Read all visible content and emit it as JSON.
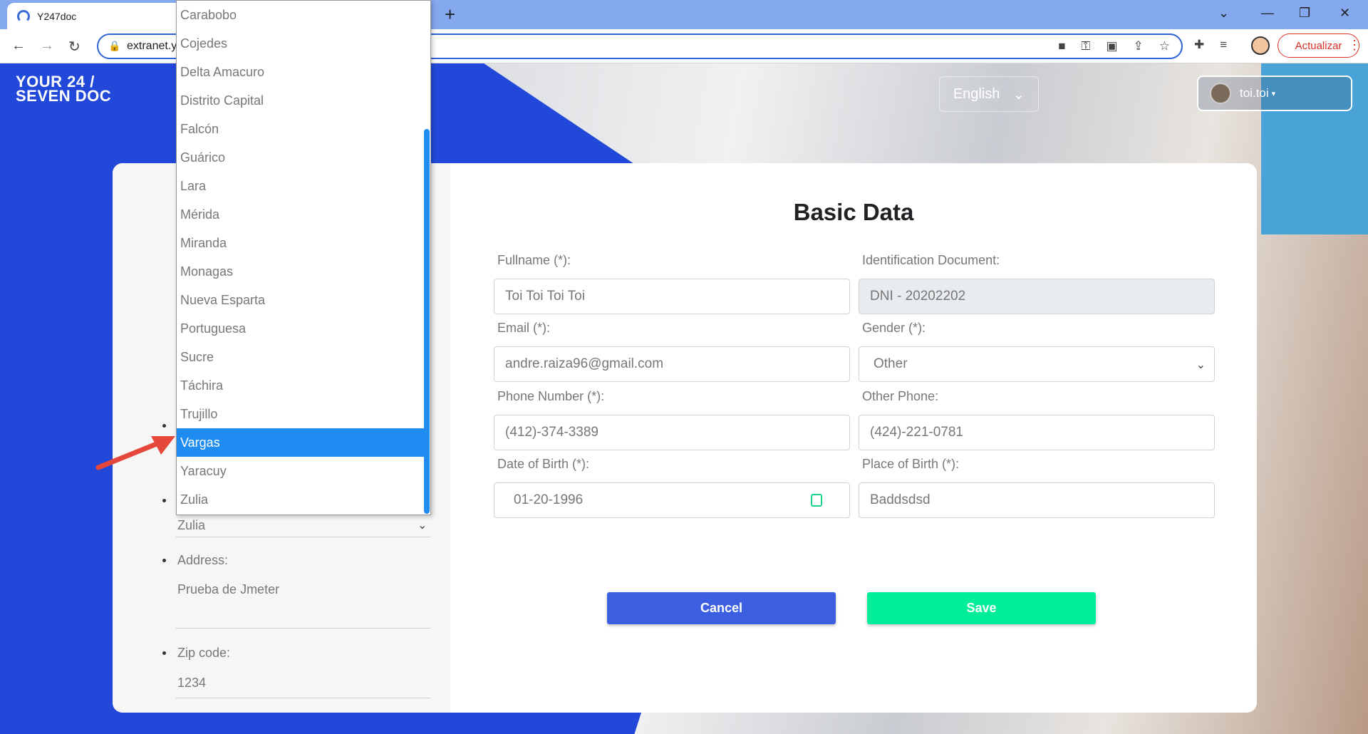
{
  "browser": {
    "tab_title": "Y247doc",
    "new_tab_icon": "plus-icon",
    "url": "extranet.y",
    "update_label": "Actualizar",
    "window_controls": [
      "⌄",
      "—",
      "❐",
      "✕"
    ]
  },
  "header": {
    "logo_line1": "YOUR 24 /",
    "logo_line2": "SEVEN DOC",
    "language": "English",
    "username": "toi.toi"
  },
  "left_panel": {
    "state_value": "Zulia",
    "address_label": "Address:",
    "address_value": "Prueba de Jmeter",
    "zip_label": "Zip code:",
    "zip_value": "1234"
  },
  "state_dropdown": {
    "options": [
      "Carabobo",
      "Cojedes",
      "Delta Amacuro",
      "Distrito Capital",
      "Falcón",
      "Guárico",
      "Lara",
      "Mérida",
      "Miranda",
      "Monagas",
      "Nueva Esparta",
      "Portuguesa",
      "Sucre",
      "Táchira",
      "Trujillo",
      "Vargas",
      "Yaracuy",
      "Zulia"
    ],
    "highlighted": "Vargas"
  },
  "form": {
    "title": "Basic Data",
    "fullname_label": "Fullname (*):",
    "fullname_value": "Toi Toi Toi Toi",
    "id_label": "Identification Document:",
    "id_value": "DNI - 20202202",
    "email_label": "Email (*):",
    "email_value": "andre.raiza96@gmail.com",
    "gender_label": "Gender (*):",
    "gender_value": "Other",
    "phone_label": "Phone Number (*):",
    "phone_value": "(412)-374-3389",
    "other_phone_label": "Other Phone:",
    "other_phone_value": "(424)-221-0781",
    "dob_label": "Date of Birth (*):",
    "dob_value": "01-20-1996",
    "pob_label": "Place of Birth (*):",
    "pob_value": "Baddsdsd",
    "cancel_label": "Cancel",
    "save_label": "Save"
  },
  "colors": {
    "brand_blue": "#2248da",
    "cancel_blue": "#3b5fe0",
    "save_green": "#00ee99",
    "highlight": "#1e8cf1",
    "arrow_red": "#e5473b"
  }
}
